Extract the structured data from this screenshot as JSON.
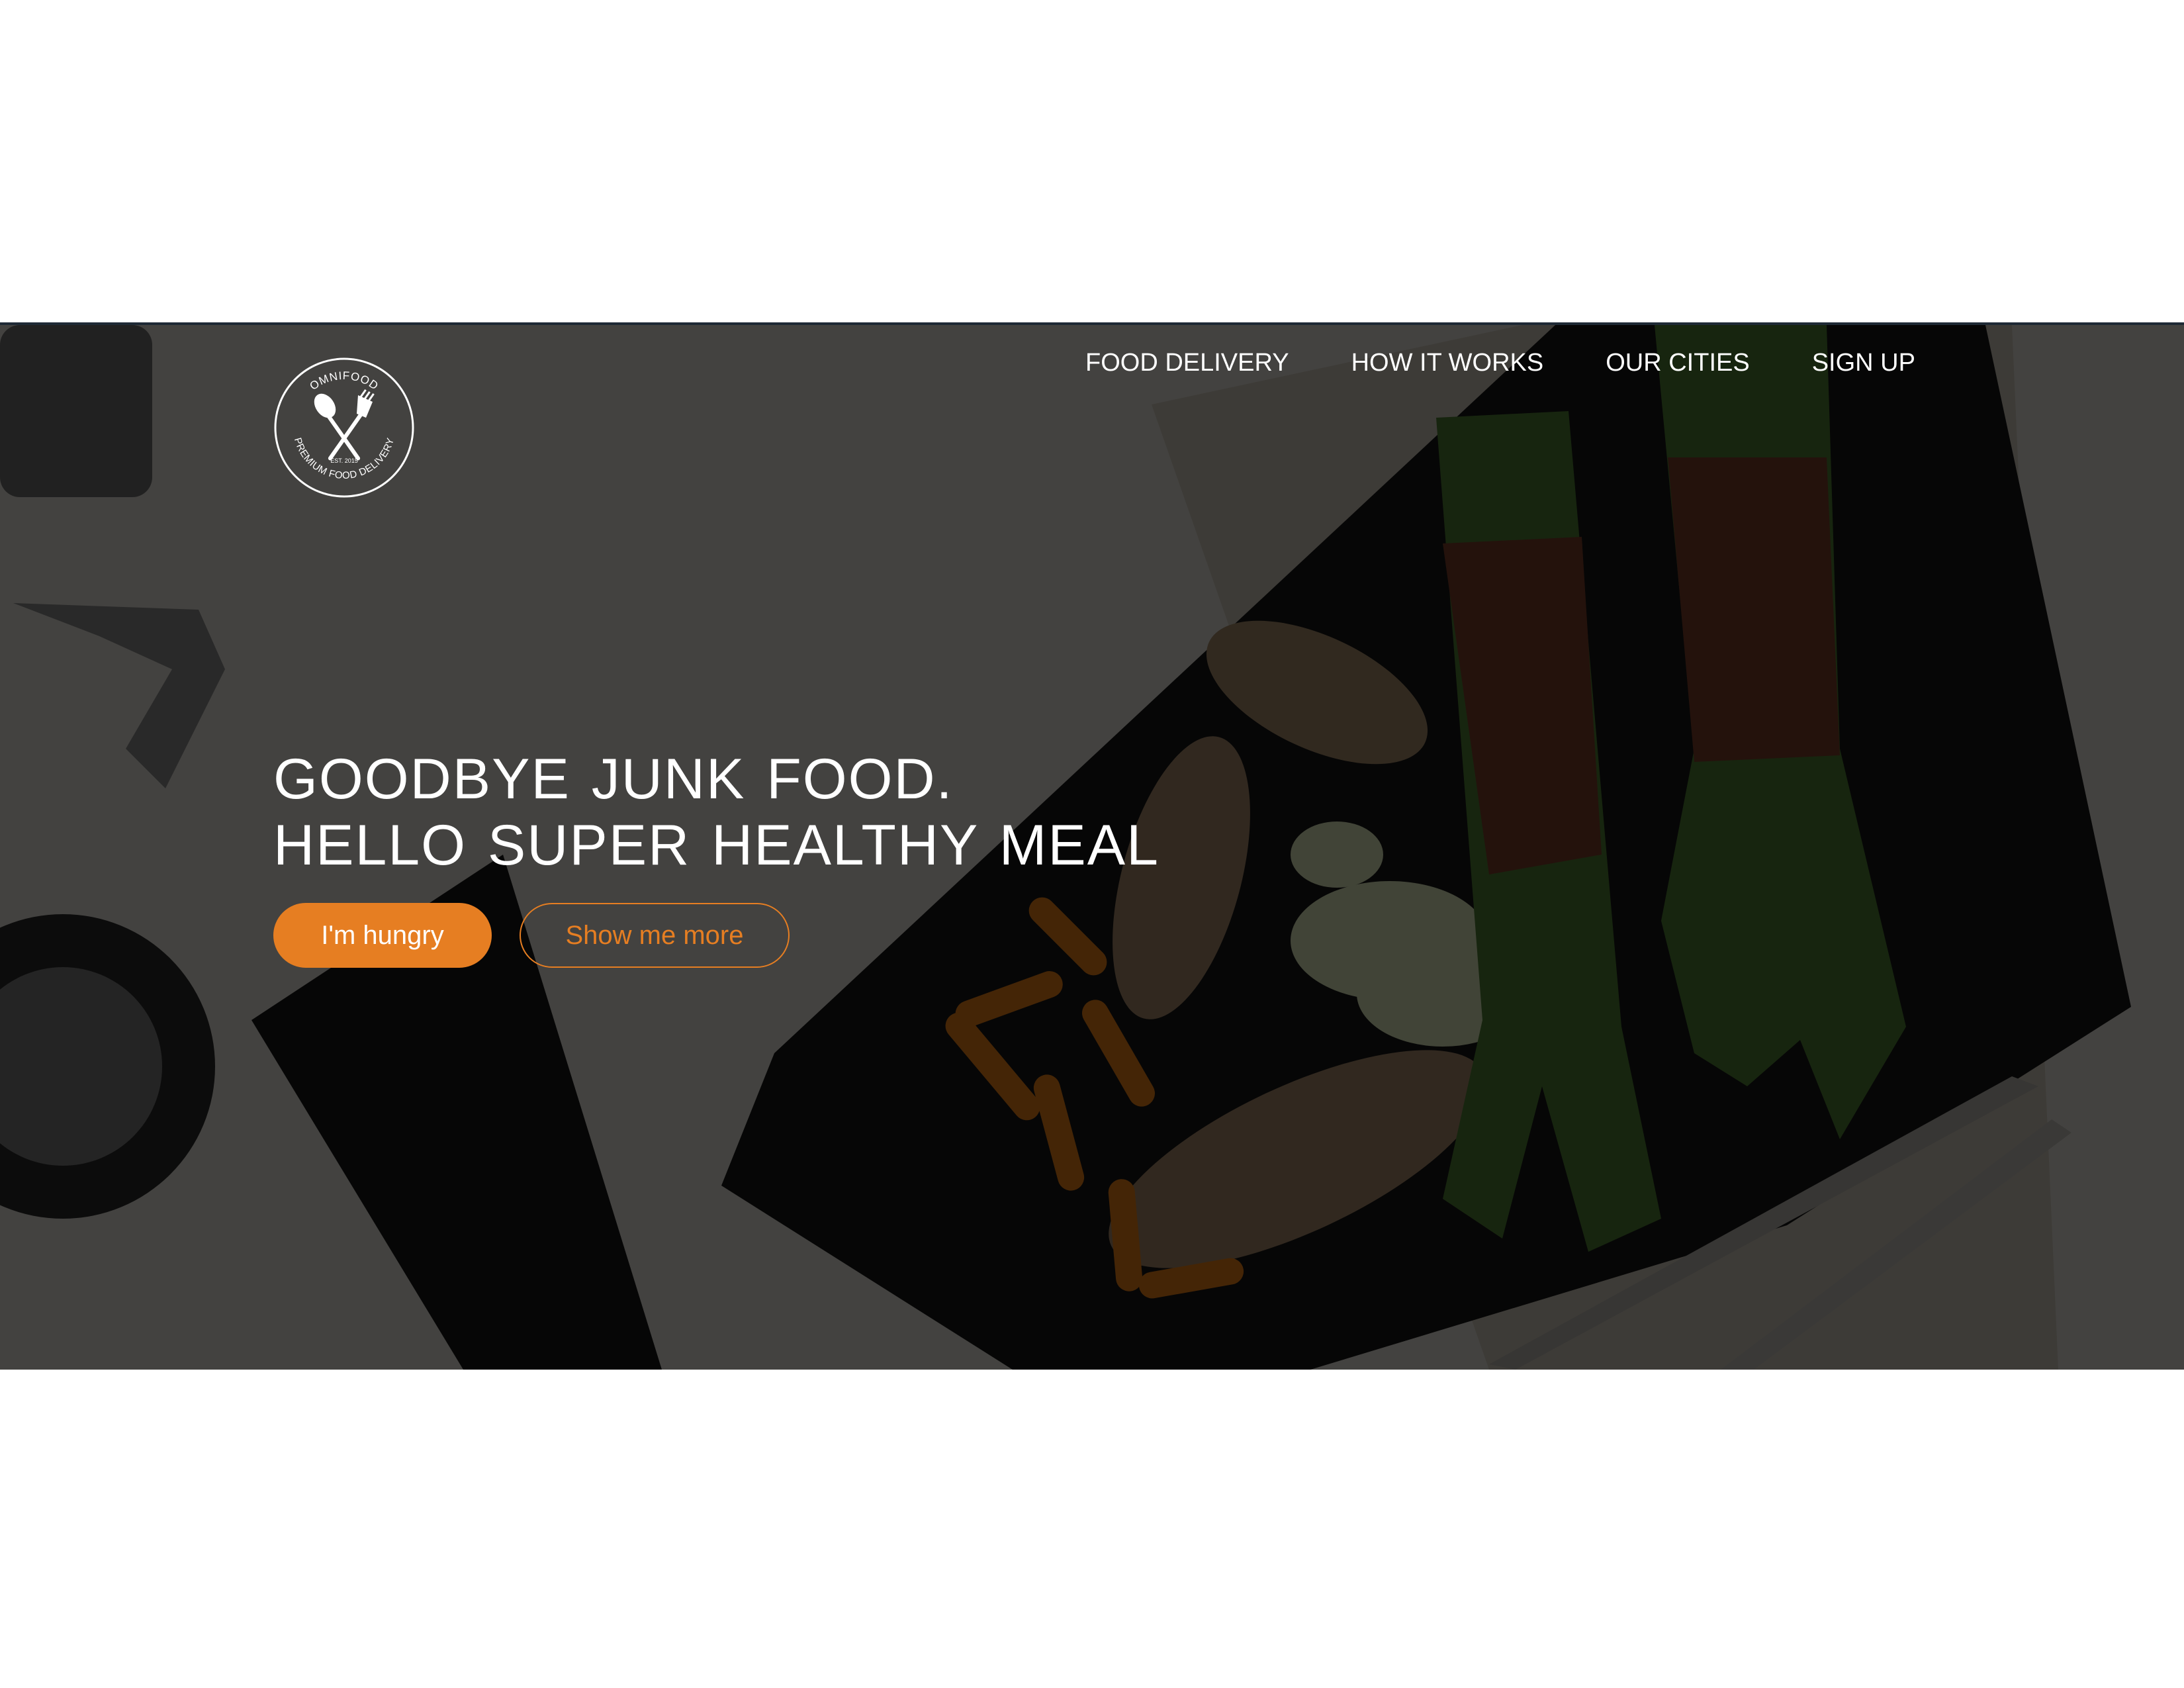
{
  "brand": {
    "logo_arc_top": "OMNIFOOD",
    "logo_est": "EST. 2015",
    "logo_arc_bottom": "PREMIUM FOOD DELIVERY"
  },
  "nav": {
    "items": [
      {
        "label": "FOOD DELIVERY"
      },
      {
        "label": "HOW IT WORKS"
      },
      {
        "label": "OUR CITIES"
      },
      {
        "label": "SIGN UP"
      }
    ]
  },
  "hero": {
    "headline_line1": "GOODBYE JUNK FOOD.",
    "headline_line2": "HELLO SUPER HEALTHY MEAL",
    "primary_button": "I'm hungry",
    "secondary_button": "Show me more"
  },
  "colors": {
    "accent": "#e67e22",
    "text": "#ffffff",
    "overlay": "rgba(0,0,0,0.70)"
  }
}
